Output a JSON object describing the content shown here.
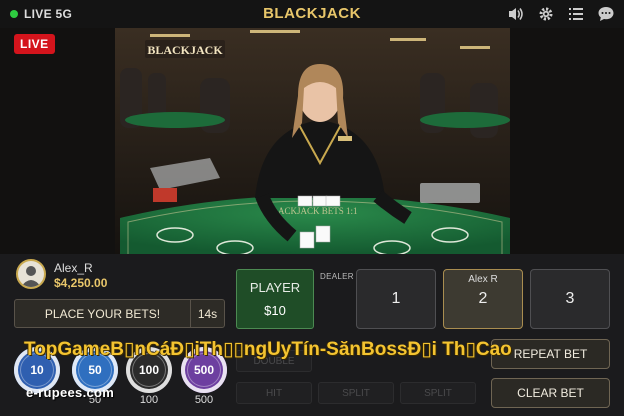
{
  "topbar": {
    "live_label": "LIVE 5G",
    "title": "BLACKJACK",
    "icons": [
      "volume-icon",
      "gear-icon",
      "menu-icon",
      "chat-icon"
    ]
  },
  "video": {
    "live_badge": "LIVE",
    "sign_text": "BLACKJACK",
    "table_text": "BLACKJACK BETS 1:1"
  },
  "user": {
    "name": "Alex_R",
    "balance": "$4,250.00"
  },
  "status": {
    "place_bets": "PLACE YOUR BETS!",
    "timer": "14s"
  },
  "player_box": {
    "label": "PLAYER",
    "value": "$10"
  },
  "dealer_label": "DEALER",
  "seats": [
    {
      "number": "1",
      "name": ""
    },
    {
      "number": "2",
      "name": "Alex R"
    },
    {
      "number": "3",
      "name": ""
    }
  ],
  "ghost_buttons": {
    "double": "DOUBLE",
    "hit": "HIT",
    "split1": "SPLIT",
    "split2": "SPLIT"
  },
  "actions": {
    "repeat_bet": "REPEAT BET",
    "clear_bet": "CLEAR BET"
  },
  "chips": [
    {
      "value": "10",
      "color": "#2f5fb0"
    },
    {
      "value": "50",
      "color": "#2f6fbf"
    },
    {
      "value": "100",
      "color": "#2b2b2b"
    },
    {
      "value": "500",
      "color": "#6d3fa0"
    }
  ],
  "watermark": {
    "text": "TopGameB▯nCáĐ▯iTh▯▯ngUyTín-SănBossĐ▯i Th▯Cao",
    "url": "e-rupees.com"
  },
  "colors": {
    "accent_gold": "#e8c66a",
    "live_red": "#d4141c",
    "live_green": "#2ecc40",
    "felt_green": "#1d6b3a"
  }
}
